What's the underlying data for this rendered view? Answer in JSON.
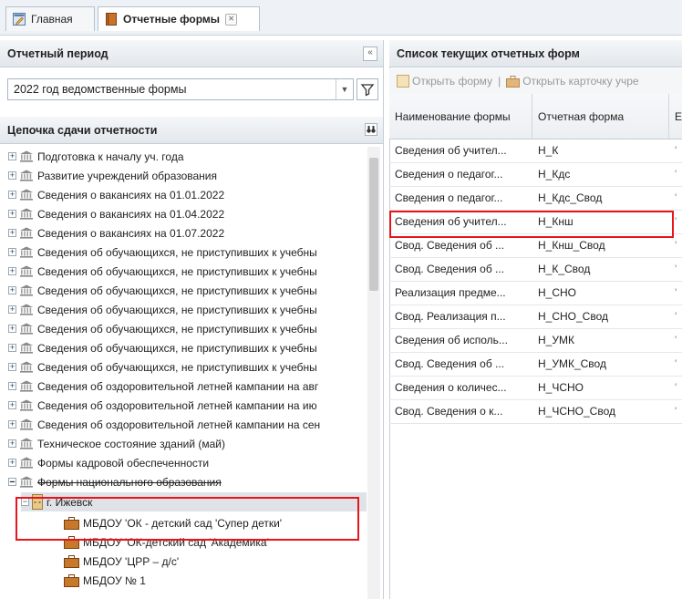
{
  "tabs": [
    {
      "label": "Главная"
    },
    {
      "label": "Отчетные формы"
    }
  ],
  "period_panel": {
    "title": "Отчетный период",
    "selected": "2022 год ведомственные формы"
  },
  "chain_panel": {
    "title": "Цепочка сдачи отчетности",
    "nodes": [
      "Подготовка к началу уч. года",
      "Развитие учреждений образования",
      "Сведения о вакансиях на 01.01.2022",
      "Сведения о вакансиях на 01.04.2022",
      "Сведения о вакансиях на 01.07.2022",
      "Сведения об обучающихся, не приступивших к учебны",
      "Сведения об обучающихся, не приступивших к учебны",
      "Сведения об обучающихся, не приступивших к учебны",
      "Сведения об обучающихся, не приступивших к учебны",
      "Сведения об обучающихся, не приступивших к учебны",
      "Сведения об обучающихся, не приступивших к учебны",
      "Сведения об обучающихся, не приступивших к учебны",
      "Сведения об оздоровительной летней кампании на авг",
      "Сведения об оздоровительной летней кампании на ию",
      "Сведения об оздоровительной летней кампании на сен",
      "Техническое состояние зданий (май)",
      "Формы кадровой обеспеченности",
      "Формы национального образования"
    ],
    "city": "г. Ижевск",
    "institutions": [
      "МБДОУ 'ОК - детский сад 'Супер детки'",
      "МБДОУ 'ОК-детский сад 'Академика'",
      "МБДОУ 'ЦРР – д/с'",
      "МБДОУ № 1"
    ]
  },
  "forms_panel": {
    "title": "Список текущих отчетных форм",
    "toolbar": {
      "open_form": "Открыть форму",
      "separator": "|",
      "open_card": "Открыть карточку учре"
    },
    "columns": [
      "Наименование формы",
      "Отчетная форма",
      "Е"
    ],
    "rows": [
      {
        "name": "Сведения об учител...",
        "form": "Н_К"
      },
      {
        "name": "Сведения о педагог...",
        "form": "Н_Кдс"
      },
      {
        "name": "Сведения о педагог...",
        "form": "Н_Кдс_Свод"
      },
      {
        "name": "Сведения об учител...",
        "form": "Н_Кнш"
      },
      {
        "name": "Свод. Сведения об ...",
        "form": "Н_Кнш_Свод"
      },
      {
        "name": "Свод. Сведения об ...",
        "form": "Н_К_Свод"
      },
      {
        "name": "Реализация предме...",
        "form": "Н_СНО"
      },
      {
        "name": "Свод. Реализация п...",
        "form": "Н_СНО_Свод"
      },
      {
        "name": "Сведения об исполь...",
        "form": "Н_УМК"
      },
      {
        "name": "Свод. Сведения об ...",
        "form": "Н_УМК_Свод"
      },
      {
        "name": "Сведения о количес...",
        "form": "Н_ЧСНО"
      },
      {
        "name": "Свод. Сведения о к...",
        "form": "Н_ЧСНО_Свод"
      }
    ],
    "row_marker": "'"
  },
  "colors": {
    "highlight": "#e8141b",
    "header_bg": "#e2e7ec",
    "folder": "#c8782b"
  },
  "icons": {
    "home_tab": "pencil-window-icon",
    "forms_tab": "book-icon",
    "tree_node": "bank-icon",
    "institution": "briefcase-icon"
  }
}
